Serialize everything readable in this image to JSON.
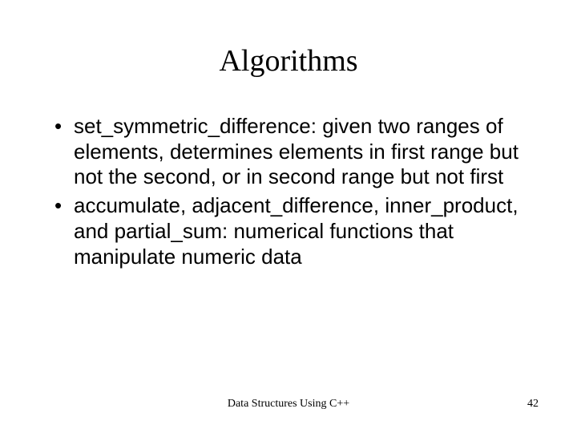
{
  "title": "Algorithms",
  "bullets": [
    "set_symmetric_difference: given two ranges of elements, determines elements in first range but not the second, or in second range but not first",
    "accumulate, adjacent_difference, inner_product, and partial_sum: numerical functions that manipulate numeric data"
  ],
  "footer": {
    "center": "Data Structures Using C++",
    "page": "42"
  }
}
